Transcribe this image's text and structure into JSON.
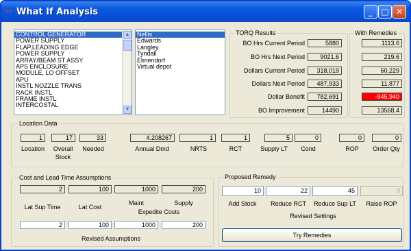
{
  "window": {
    "title": "What If Analysis",
    "icon_text": "⑂⑂",
    "min_glyph": "_",
    "max_glyph": "□",
    "close_glyph": "✕"
  },
  "components": {
    "items": [
      "CONTROL GENERATOR",
      "POWER SUPPLY",
      "FLAP,LEADING EDGE",
      "POWER SUPPLY",
      "ARRAY/BEAM ST ASSY",
      "APS ENCLOSURE",
      "MODULE, LO OFFSET",
      "APU",
      "INSTL NOZZLE TRANS",
      "RACK INSTL",
      "FRAME INSTL",
      "INTERCOSTAL"
    ],
    "selected_index": 0
  },
  "locations": {
    "items": [
      "Nellis",
      "Edwards",
      "Langley",
      "Tyndall",
      "Elmendorf",
      "Virtual depot"
    ],
    "selected_index": 0
  },
  "torq": {
    "title": "TORQ Results",
    "rows": [
      {
        "label": "BO Hrs Current Period",
        "value": "5880"
      },
      {
        "label": "BO Hrs Next Period",
        "value": "9021.6"
      },
      {
        "label": "Dollars Current Period",
        "value": "318,019"
      },
      {
        "label": "Dollars Next Period",
        "value": "487,933"
      },
      {
        "label": "Dollar Benefit",
        "value": "782,691"
      },
      {
        "label": "BO Improvement",
        "value": "14490"
      }
    ]
  },
  "remedies": {
    "title": "With Remedies",
    "values": [
      "1113.6",
      "219.6",
      "60,229",
      "11,877",
      "-945,940",
      "13568.4"
    ]
  },
  "location_data": {
    "title": "Location Data",
    "values": {
      "location": "1",
      "overall_stock": "17",
      "needed": "33",
      "annual_dmd": "4.208267",
      "nrts": "1",
      "rct": "1",
      "supply_lt": "5",
      "cond": "0",
      "rop": "0",
      "order_qty": "0"
    },
    "labels": {
      "location": "Location",
      "overall_stock_1": "Overall",
      "overall_stock_2": "Stock",
      "needed": "Needed",
      "annual_dmd": "Annual Dmd",
      "nrts": "NRTS",
      "rct": "RCT",
      "supply_lt": "Supply LT",
      "cond": "Cond",
      "rop": "ROP",
      "order_qty": "Order Qty"
    }
  },
  "cost_lead": {
    "title": "Cost and Lead Time Assumptions",
    "current": {
      "lat_sup_time": "2",
      "lat_cost": "100",
      "maint": "1000",
      "supply": "200"
    },
    "revised": {
      "lat_sup_time": "2",
      "lat_cost": "100",
      "maint": "1000",
      "supply": "200"
    },
    "labels": {
      "lat_sup_time": "Lat Sup Time",
      "lat_cost": "Lat Cost",
      "maint": "Maint",
      "supply": "Supply",
      "expedite_costs": "Expedite Costs",
      "revised_assumptions": "Revised Assumptions"
    }
  },
  "remedy": {
    "title": "Proposed Remedy",
    "values": {
      "add_stock": "10",
      "reduce_rct": "22",
      "reduce_sup_lt": "45",
      "raise_rop": "0"
    },
    "labels": {
      "add_stock": "Add Stock",
      "reduce_rct": "Reduce RCT",
      "reduce_sup_lt": "Reduce Sup LT",
      "raise_rop": "Raise ROP",
      "revised_settings": "Revised Settings"
    },
    "try_button": "Try Remedies"
  }
}
